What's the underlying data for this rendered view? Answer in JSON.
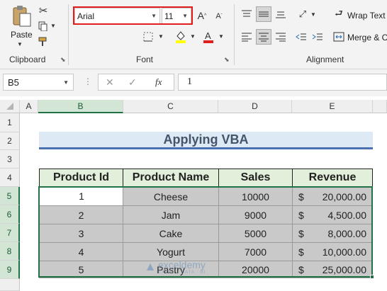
{
  "ribbon": {
    "clipboard": {
      "paste_label": "Paste",
      "group_label": "Clipboard"
    },
    "font": {
      "font_name": "Arial",
      "font_size": "11",
      "group_label": "Font"
    },
    "alignment": {
      "wrap_text_label": "Wrap Text",
      "merge_label": "Merge & C",
      "group_label": "Alignment"
    }
  },
  "formula_bar": {
    "name_box": "B5",
    "fx_label": "fx",
    "value": "1"
  },
  "columns": [
    "A",
    "B",
    "C",
    "D",
    "E"
  ],
  "rows": [
    "1",
    "2",
    "3",
    "4",
    "5",
    "6",
    "7",
    "8",
    "9"
  ],
  "sheet": {
    "title": "Applying VBA",
    "headers": [
      "Product Id",
      "Product Name",
      "Sales",
      "Revenue"
    ],
    "currency_symbol": "$",
    "data": [
      {
        "id": "1",
        "name": "Cheese",
        "sales": "10000",
        "revenue": "20,000.00"
      },
      {
        "id": "2",
        "name": "Jam",
        "sales": "9000",
        "revenue": "4,500.00"
      },
      {
        "id": "3",
        "name": "Cake",
        "sales": "5000",
        "revenue": "8,000.00"
      },
      {
        "id": "4",
        "name": "Yogurt",
        "sales": "7000",
        "revenue": "10,000.00"
      },
      {
        "id": "5",
        "name": "Pastry",
        "sales": "20000",
        "revenue": "25,000.00"
      }
    ]
  },
  "watermark": {
    "brand": "exceldemy",
    "tagline": "EXCEL · DATA · BI"
  },
  "colors": {
    "excel_green": "#217346",
    "header_fill": "#e2efda",
    "data_fill": "#c9c9c9",
    "highlight_red": "#e01e1e"
  }
}
